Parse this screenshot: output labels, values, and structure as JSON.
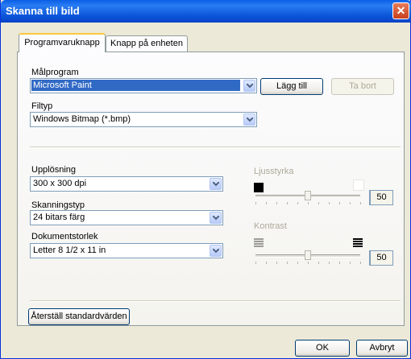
{
  "window": {
    "title": "Skanna till bild",
    "close_glyph": "✕"
  },
  "tabs": [
    {
      "label": "Programvaruknapp",
      "active": true
    },
    {
      "label": "Knapp på enheten",
      "active": false
    }
  ],
  "target_app": {
    "label": "Målprogram",
    "value": "Microsoft Paint",
    "add_label": "Lägg till",
    "remove_label": "Ta bort"
  },
  "file_type": {
    "label": "Filtyp",
    "value": "Windows Bitmap (*.bmp)"
  },
  "resolution": {
    "label": "Upplösning",
    "value": "300 x 300 dpi"
  },
  "scan_type": {
    "label": "Skanningstyp",
    "value": "24 bitars färg"
  },
  "doc_size": {
    "label": "Dokumentstorlek",
    "value": "Letter 8 1/2 x 11 in"
  },
  "brightness": {
    "label": "Ljusstyrka",
    "value": "50",
    "level": 50,
    "enabled": false
  },
  "contrast": {
    "label": "Kontrast",
    "value": "50",
    "level": 50,
    "enabled": false
  },
  "restore_defaults_label": "Återställ standardvärden",
  "ok_label": "OK",
  "cancel_label": "Avbryt",
  "colors": {
    "title_bar": "#0b55d9",
    "selection": "#316ac5",
    "tab_accent": "#ffc83c",
    "dialog_bg": "#ece9d8"
  }
}
